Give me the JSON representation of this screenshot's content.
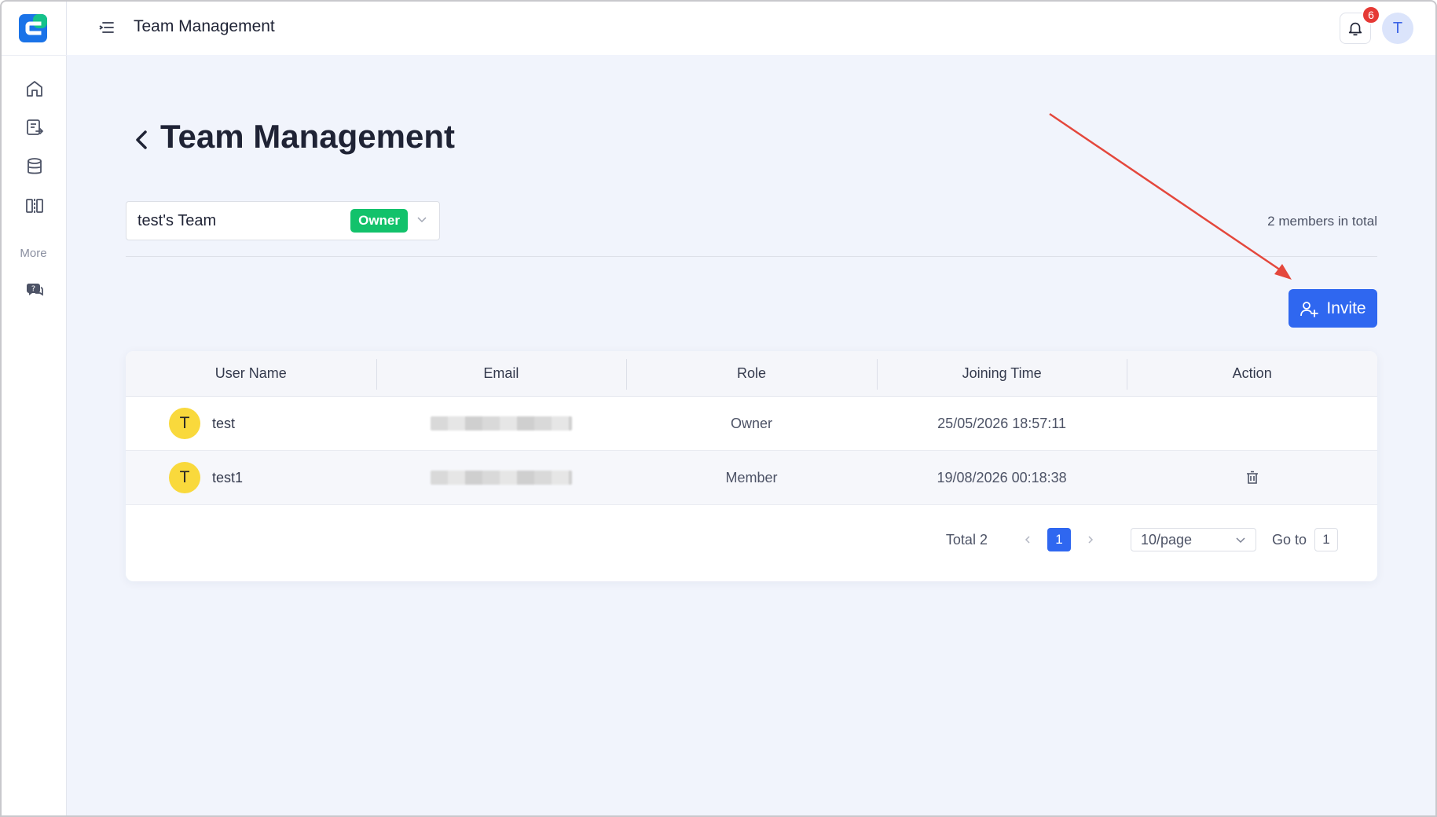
{
  "app": {
    "brand_color": "#1a73e8",
    "accent_color": "#2f67f0"
  },
  "header": {
    "title": "Team Management",
    "notification_count": "6",
    "user_initial": "T"
  },
  "sidebar": {
    "items": [
      {
        "icon": "home-icon"
      },
      {
        "icon": "document-export-icon"
      },
      {
        "icon": "database-icon"
      },
      {
        "icon": "compare-columns-icon"
      }
    ],
    "more_label": "More",
    "more_items": [
      {
        "icon": "support-chat-icon"
      }
    ]
  },
  "page": {
    "title": "Team Management",
    "team_select": {
      "value": "test's Team",
      "role_badge": "Owner"
    },
    "members_total": "2 members in total",
    "invite_label": "Invite"
  },
  "table": {
    "columns": [
      "User Name",
      "Email",
      "Role",
      "Joining Time",
      "Action"
    ],
    "rows": [
      {
        "avatar": "T",
        "name": "test",
        "role": "Owner",
        "joined": "25/05/2026 18:57:11"
      },
      {
        "avatar": "T",
        "name": "test1",
        "role": "Member",
        "joined": "19/08/2026 00:18:38"
      }
    ]
  },
  "pagination": {
    "total_label": "Total 2",
    "current_page": "1",
    "page_size": "10/page",
    "goto_label": "Go to",
    "goto_value": "1"
  }
}
